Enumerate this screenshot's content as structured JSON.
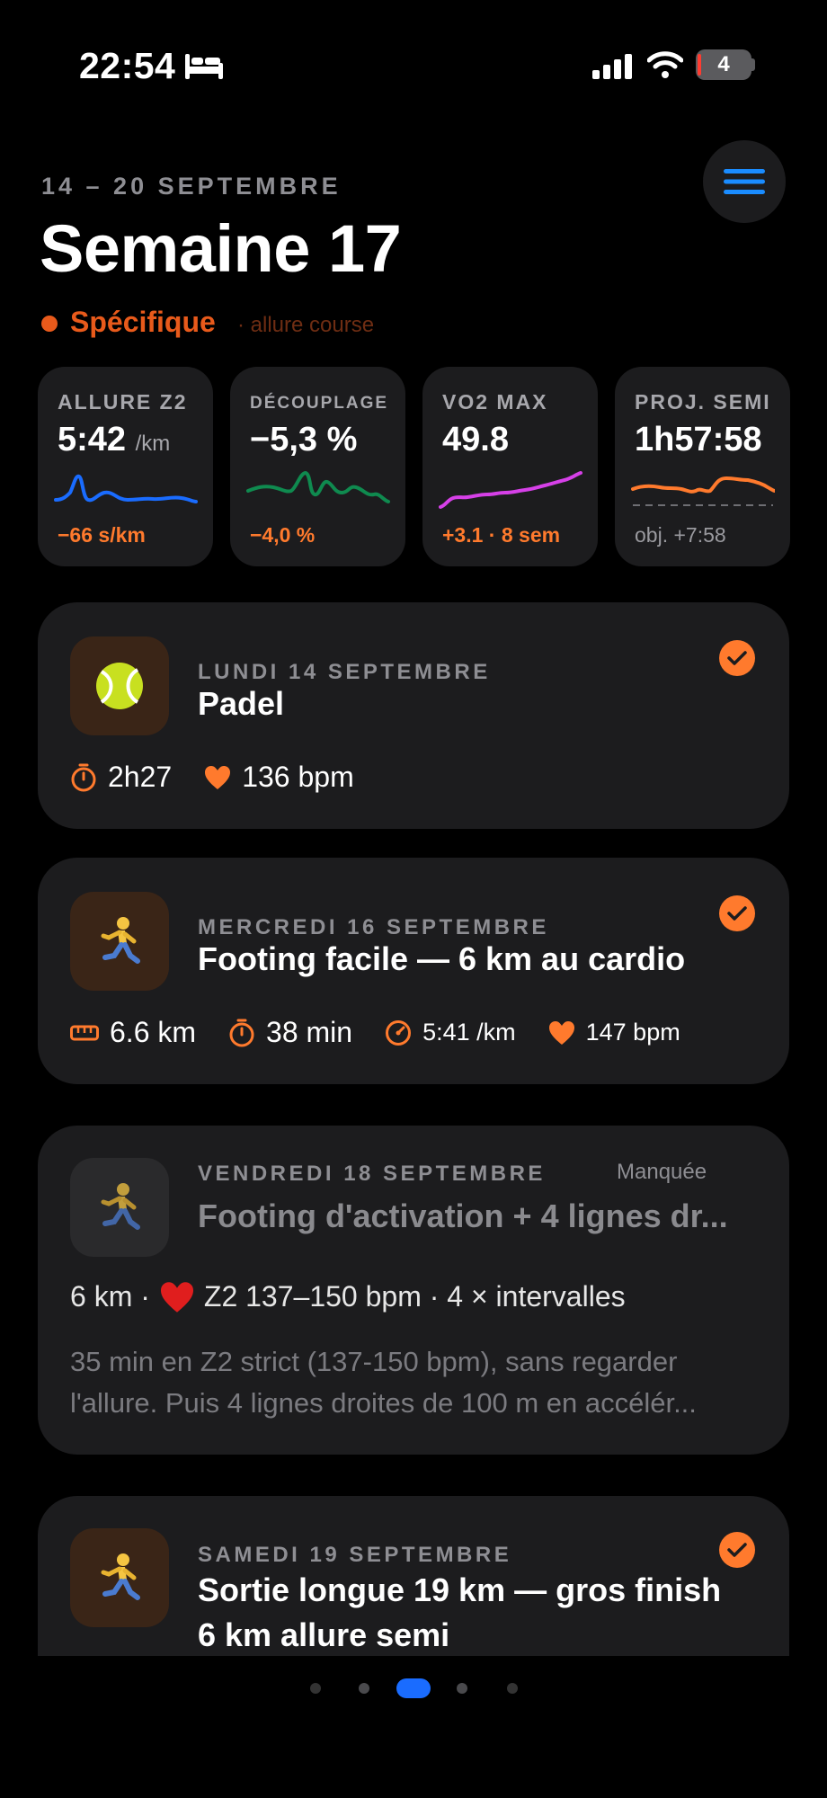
{
  "status_bar": {
    "time": "22:54",
    "battery": "4"
  },
  "header": {
    "date_range": "14 – 20 SEPTEMBRE",
    "title": "Semaine 17",
    "phase": "Spécifique",
    "phase_detail": "· allure course"
  },
  "metrics": [
    {
      "label": "ALLURE Z2",
      "value": "5:42",
      "unit": "/km",
      "delta": "−66 s/km",
      "color": "#1a6cff"
    },
    {
      "label": "DÉCOUPLAGE",
      "value": "−5,3 %",
      "unit": "",
      "delta": "−4,0 %",
      "color": "#0f8a4f"
    },
    {
      "label": "VO2 MAX",
      "value": "49.8",
      "unit": "",
      "delta": "+3.1 · 8 sem",
      "color": "#d640e8"
    },
    {
      "label": "PROJ. SEMI",
      "value": "1h57:58",
      "unit": "",
      "delta": "obj. +7:58",
      "color": "#ff7a2d"
    }
  ],
  "sessions": [
    {
      "day": "LUNDI 14 SEPTEMBRE",
      "title": "Padel",
      "icon": "tennis-ball-icon",
      "completed": true,
      "duration": "2h27",
      "heart_rate": "136 bpm"
    },
    {
      "day": "MERCREDI 16 SEPTEMBRE",
      "title": "Footing facile — 6 km au cardio",
      "icon": "runner-icon",
      "completed": true,
      "distance": "6.6 km",
      "duration": "38 min",
      "pace": "5:41 /km",
      "heart_rate": "147 bpm"
    },
    {
      "day": "VENDREDI 18 SEPTEMBRE",
      "title": "Footing d'activation + 4 lignes dr...",
      "icon": "runner-icon",
      "status": "Manquée",
      "plan_prefix": "6 km ·",
      "plan_suffix": "Z2 137–150 bpm · 4 × intervalles",
      "description": "35 min en Z2 strict (137-150 bpm), sans regarder l'allure. Puis 4 lignes droites de 100 m en accélér..."
    },
    {
      "day": "SAMEDI 19 SEPTEMBRE",
      "title_line1": "Sortie longue 19 km — gros finish",
      "title_line2": "6 km allure semi",
      "icon": "runner-icon",
      "completed": true
    }
  ],
  "pagination": {
    "total": 5,
    "active": 3
  },
  "colors": {
    "accent": "#ff7a2d",
    "blue": "#1a6cff",
    "phase": "#e85a1b",
    "card": "#1c1c1e"
  }
}
